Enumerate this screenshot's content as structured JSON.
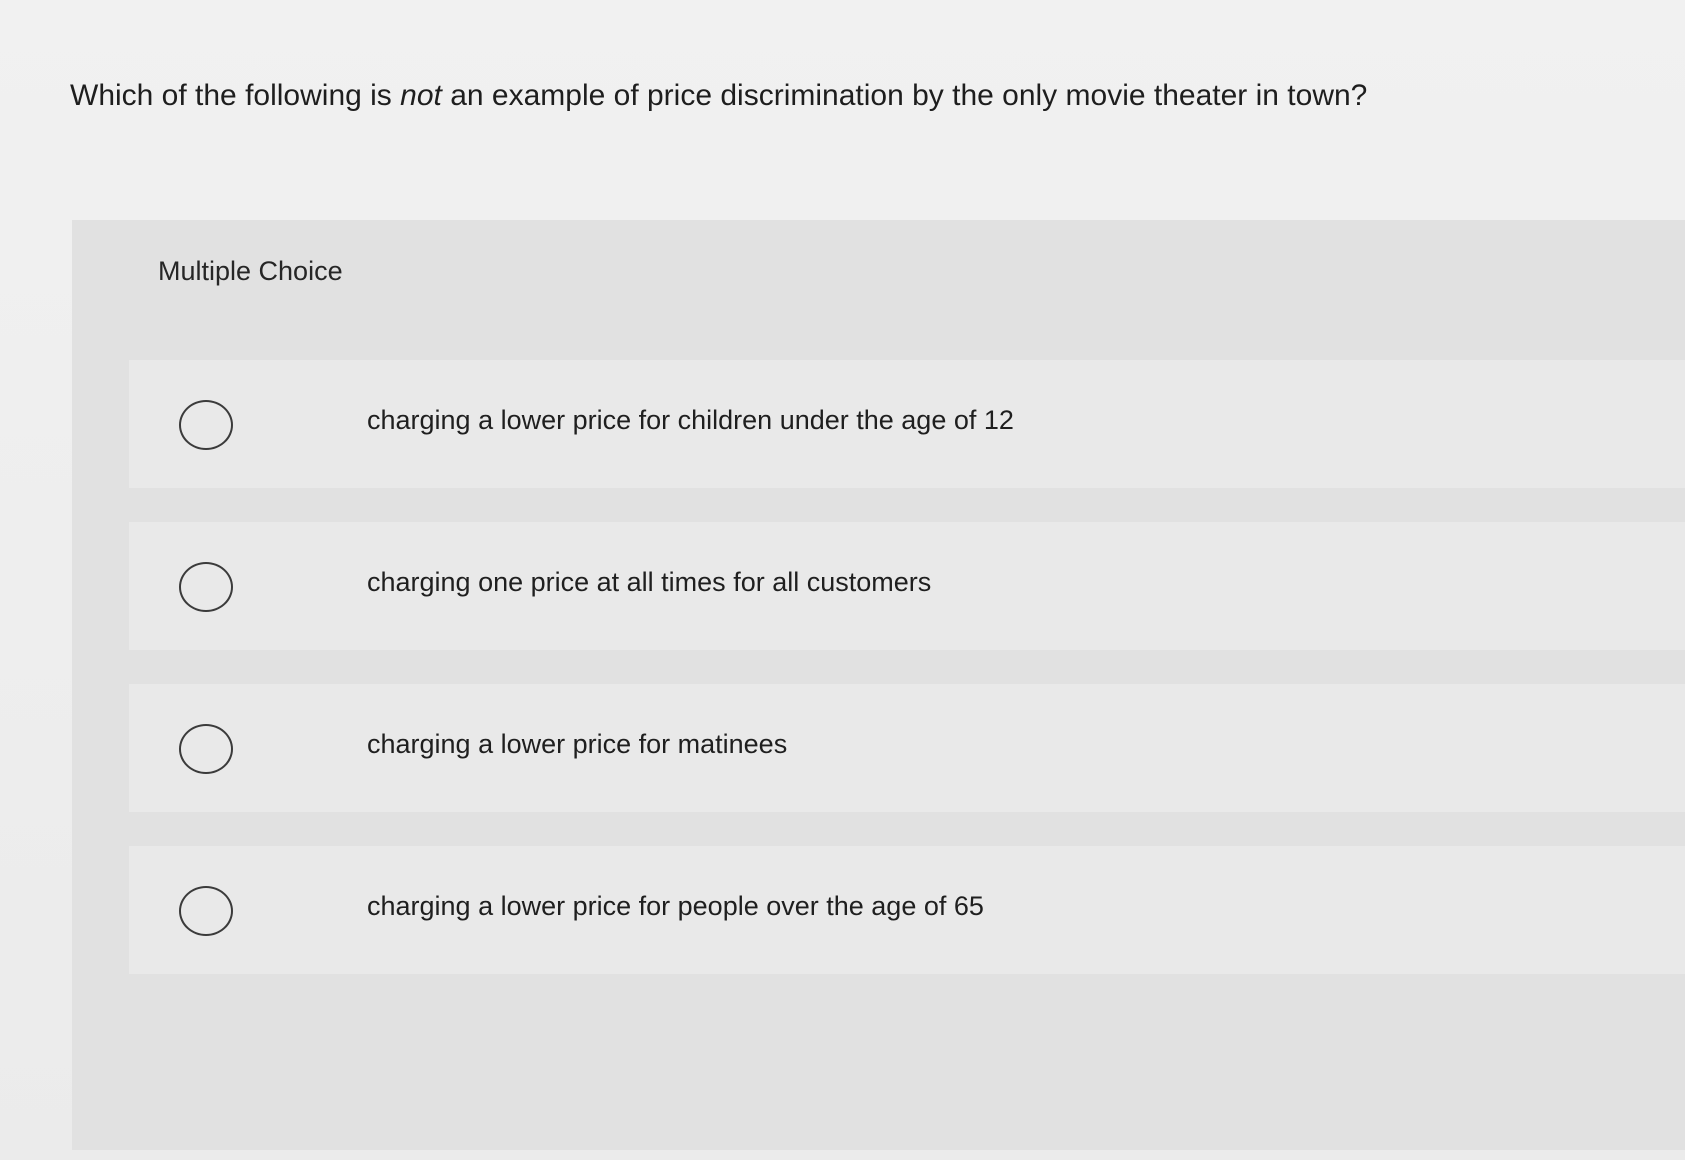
{
  "question": {
    "prefix": "Which of the following is ",
    "emphasis": "not",
    "suffix": " an example of price discrimination by the only movie theater in town?"
  },
  "multiple_choice": {
    "heading": "Multiple Choice",
    "options": [
      {
        "label": "charging a lower price for children under the age of 12",
        "selected": false
      },
      {
        "label": "charging one price at all times for all customers",
        "selected": false
      },
      {
        "label": "charging a lower price for matinees",
        "selected": false
      },
      {
        "label": "charging a lower price for people over the age of 65",
        "selected": false
      }
    ]
  }
}
